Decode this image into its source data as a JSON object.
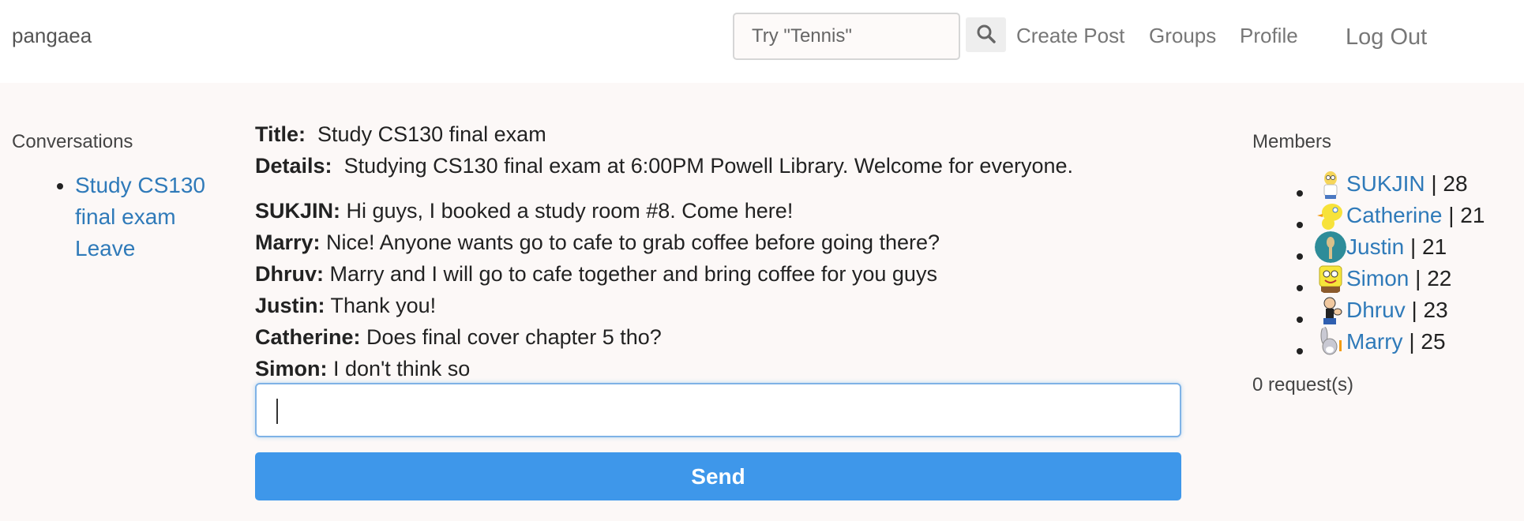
{
  "nav": {
    "brand": "pangaea",
    "search_placeholder": "Try \"Tennis\"",
    "search_icon": "magnifier-icon",
    "create_post": "Create Post",
    "groups": "Groups",
    "profile": "Profile",
    "logout": "Log Out"
  },
  "conversations": {
    "heading": "Conversations",
    "items": [
      {
        "label": "Study CS130 final exam"
      },
      {
        "label": "Leave"
      }
    ]
  },
  "post": {
    "title_label": "Title:",
    "title": "Study CS130 final exam",
    "details_label": "Details:",
    "details": "Studying CS130 final exam at 6:00PM Powell Library. Welcome for everyone."
  },
  "messages": [
    {
      "author": "SUKJIN:",
      "text": "Hi guys, I booked a study room #8. Come here!"
    },
    {
      "author": "Marry:",
      "text": "Nice! Anyone wants go to cafe to grab coffee before going there?"
    },
    {
      "author": "Dhruv:",
      "text": "Marry and I will go to cafe together and bring coffee for you guys"
    },
    {
      "author": "Justin:",
      "text": "Thank you!"
    },
    {
      "author": "Catherine:",
      "text": "Does final cover chapter 5 tho?"
    },
    {
      "author": "Simon:",
      "text": "I don't think so"
    }
  ],
  "chat": {
    "input_value": "",
    "send_label": "Send"
  },
  "members": {
    "heading": "Members",
    "items": [
      {
        "name": "SUKJIN",
        "age": "| 28",
        "avatar": "cartoon-avatar-homer"
      },
      {
        "name": "Catherine",
        "age": "| 21",
        "avatar": "cartoon-avatar-tweety"
      },
      {
        "name": "Justin",
        "age": "| 21",
        "avatar": "avatar-teal-figure"
      },
      {
        "name": "Simon",
        "age": "| 22",
        "avatar": "cartoon-avatar-spongebob"
      },
      {
        "name": "Dhruv",
        "age": "| 23",
        "avatar": "cartoon-avatar-popeye"
      },
      {
        "name": "Marry",
        "age": "| 25",
        "avatar": "cartoon-avatar-bugs-bunny"
      }
    ],
    "requests": "0 request(s)"
  },
  "colors": {
    "link": "#2f7ab9",
    "send_button": "#3e97ea",
    "page_bg": "#fcf8f7",
    "nav_bg": "#ffffff"
  }
}
